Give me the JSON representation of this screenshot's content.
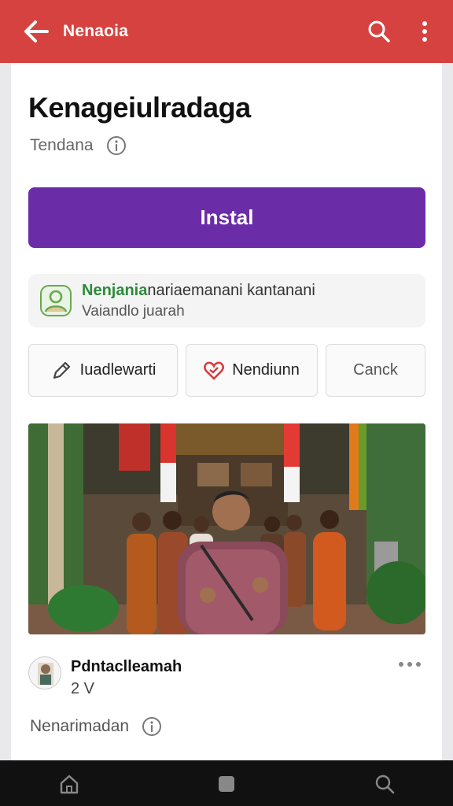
{
  "app_bar": {
    "title": "Nenaoia",
    "back_icon": "arrow-left-icon",
    "search_icon": "search-icon",
    "more_icon": "more-vertical-icon",
    "color": "#d6423f"
  },
  "app": {
    "title": "Kenageiulradaga",
    "subtitle": "Tendana",
    "install_label": "Instal",
    "install_color": "#6b2ca8"
  },
  "notice": {
    "highlight": "Nenjania",
    "rest": "nariaemanani kantanani",
    "line2": "Vaiandlo juarah"
  },
  "actions": [
    {
      "label": "Iuadlewarti",
      "icon": "pencil-icon"
    },
    {
      "label": "Nendiunn",
      "icon": "heart-icon"
    },
    {
      "label": "Canck"
    }
  ],
  "post": {
    "author": "Pdntaclleamah",
    "meta": "2 V",
    "more_icon": "more-horizontal-icon"
  },
  "footer": {
    "text": "Nenarimadan"
  },
  "nav_bar": {
    "icons": [
      "home-icon",
      "square-icon",
      "search-icon"
    ]
  }
}
